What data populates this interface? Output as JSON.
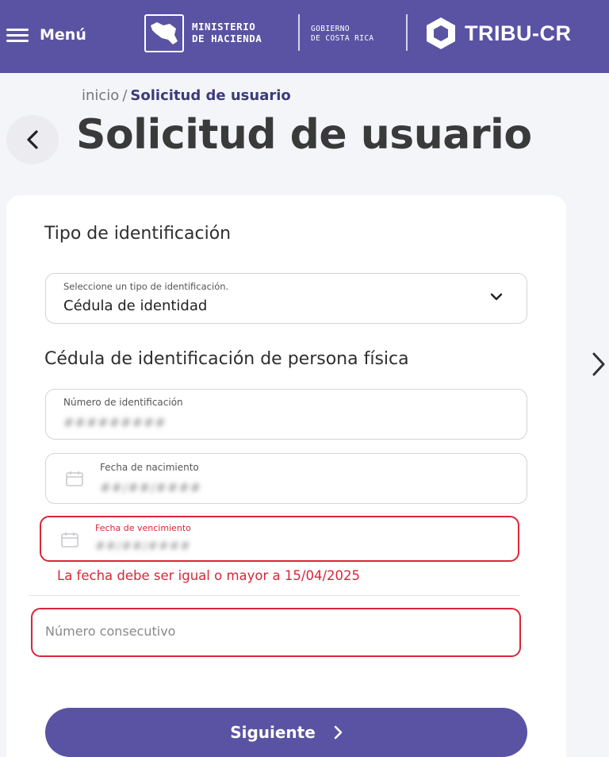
{
  "header": {
    "menu_label": "Menú",
    "ministerio_line1": "MINISTERIO",
    "ministerio_line2": "DE HACIENDA",
    "gobierno_line1": "GOBIERNO",
    "gobierno_line2": "DE COSTA RICA",
    "app_name": "TRIBU-CR",
    "brand_color": "#5a53a3"
  },
  "breadcrumb": {
    "home": "inicio",
    "separator": "/",
    "current": "Solicitud de usuario"
  },
  "page_title": "Solicitud de usuario",
  "form": {
    "id_type_section": "Tipo de identificación",
    "id_type_select": {
      "label": "Seleccione un tipo de identificación.",
      "value": "Cédula de identidad"
    },
    "person_section": "Cédula de identificación de persona física",
    "id_number": {
      "label": "Número de identificación",
      "value": "#########"
    },
    "birth_date": {
      "label": "Fecha de nacimiento",
      "value": "##/##/####"
    },
    "expiry_date": {
      "label": "Fecha de vencimiento",
      "value": "##/##/####",
      "error": "La fecha debe ser igual o mayor a 15/04/2025"
    },
    "consecutive_number": {
      "placeholder": "Número consecutivo",
      "value": ""
    },
    "submit_label": "Siguiente",
    "error_color": "#d9263a"
  }
}
